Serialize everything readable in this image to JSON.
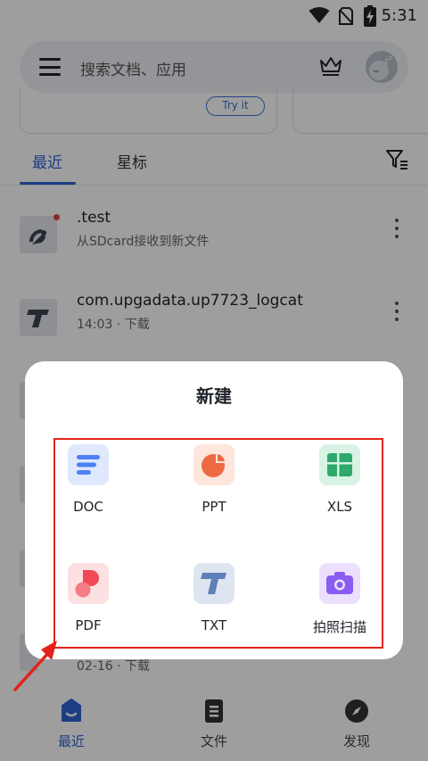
{
  "status_bar": {
    "time": "5:31"
  },
  "search": {
    "placeholder": "搜索文档、应用"
  },
  "banner": {
    "button_label": "Try it"
  },
  "tabs": [
    {
      "label": "最近"
    },
    {
      "label": "星标"
    }
  ],
  "files": [
    {
      "name": ".test",
      "subtitle": "从SDcard接收到新文件",
      "icon": "cast-file-icon",
      "unread": true
    },
    {
      "name": "com.upgadata.up7723_logcat",
      "subtitle": "14:03 · 下载",
      "icon": "txt-file-icon",
      "unread": false
    }
  ],
  "partial_file_subtitle": "02-16 · 下载",
  "dialog": {
    "title": "新建",
    "items": [
      {
        "label": "DOC",
        "icon": "doc-icon",
        "color": "#4d7ff5"
      },
      {
        "label": "PPT",
        "icon": "ppt-icon",
        "color": "#ee6a43"
      },
      {
        "label": "XLS",
        "icon": "xls-icon",
        "color": "#2ea86b"
      },
      {
        "label": "PDF",
        "icon": "pdf-icon",
        "color": "#ef4a55"
      },
      {
        "label": "TXT",
        "icon": "txt-icon",
        "color": "#5f7fb8"
      },
      {
        "label": "拍照扫描",
        "icon": "camera-icon",
        "color": "#8a5cf0"
      }
    ]
  },
  "bottom_nav": [
    {
      "label": "最近",
      "icon": "recent-icon",
      "active": true
    },
    {
      "label": "文件",
      "icon": "file-icon",
      "active": false
    },
    {
      "label": "发现",
      "icon": "compass-icon",
      "active": false
    }
  ],
  "colors": {
    "accent": "#2f63d6",
    "highlight": "#e2231a"
  }
}
